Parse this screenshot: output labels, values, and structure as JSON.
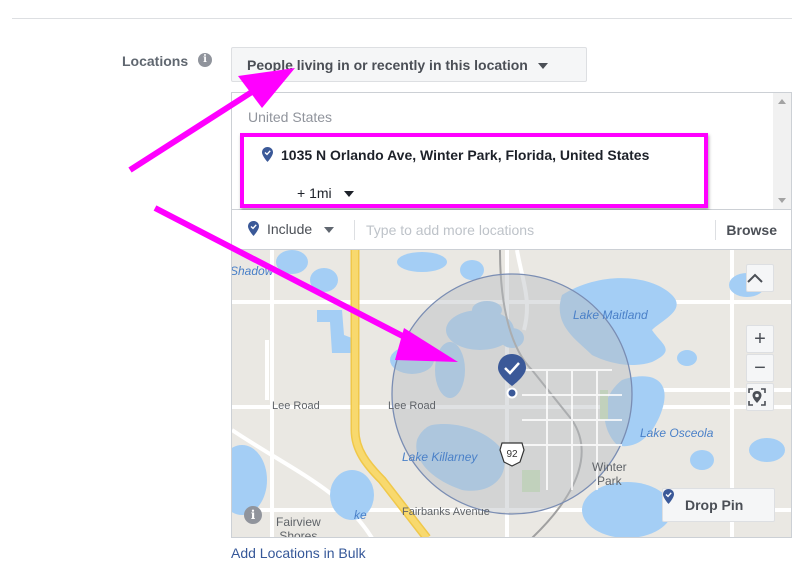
{
  "locations": {
    "label": "Locations",
    "info_icon": "info-icon",
    "audience_select": "People living in or recently in this location",
    "country": "United States",
    "selected_location": {
      "address": "1035 N Orlando Ave, Winter Park, Florida, United States",
      "radius": "+ 1mi",
      "icon": "pin-check-icon"
    },
    "include_mode": "Include",
    "search_placeholder": "Type to add more locations",
    "search_value": "",
    "browse_label": "Browse",
    "bulk_link": "Add Locations in Bulk"
  },
  "map": {
    "labels": {
      "lake_maitland": "Lake Maitland",
      "lake_osceola": "Lake Osceola",
      "lake_killarney": "Lake Killarney",
      "shadow": "Shadow",
      "winter_park": "Winter\nPark",
      "fairview_shores": "Fairview\nShores",
      "lee_road": "Lee Road",
      "lee_road_2": "Lee Road",
      "fairbanks": "Fairbanks Avenue",
      "route": "92",
      "view": "view",
      "ke": "ke"
    },
    "controls": {
      "collapse": "^",
      "zoom_in": "+",
      "zoom_out": "−"
    },
    "drop_pin_label": "Drop Pin",
    "radius_miles": 1,
    "colors": {
      "land": "#eae8e3",
      "water": "#a4cef5",
      "highway": "#f8d96e",
      "circle_fill": "#c9cbcf",
      "pin": "#3b5998",
      "annotation": "#ff00ff"
    }
  }
}
